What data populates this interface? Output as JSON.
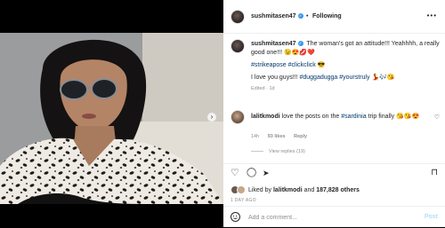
{
  "header": {
    "username": "sushmitasen47",
    "dot": "•",
    "follow_label": "Following",
    "more": "•••"
  },
  "caption": {
    "username": "sushmitasen47",
    "text": "The woman's got an attitude!!! Yeahhhh, a really good one!!! 😉😍💋❤️",
    "hashtags": "#strikeapose #clickclick 😎",
    "line3_text": "I love you guys!!! ",
    "line3_tags": "#duggadugga #yourstruly",
    "line3_emoji": " 💃🎶😘",
    "edited": "Edited · 1d"
  },
  "comment": {
    "username": "lalitkmodi",
    "text_before": "love the posts on the ",
    "tag": "#sardinia",
    "text_after": " trip finally 😘😘😍",
    "time": "14h",
    "likes": "93 likes",
    "reply": "Reply",
    "view_replies": "View replies (19)"
  },
  "actions": {
    "liked_by_prefix": "Liked by ",
    "liked_by_user": "lalitkmodi",
    "and": " and ",
    "others": "187,828 others",
    "timestamp": "1 DAY AGO"
  },
  "add_comment": {
    "placeholder": "Add a comment...",
    "post_label": "Post"
  },
  "icons": {
    "heart": "♡",
    "comment": "◯",
    "share": "➤",
    "save": "⊓",
    "next": "›"
  }
}
